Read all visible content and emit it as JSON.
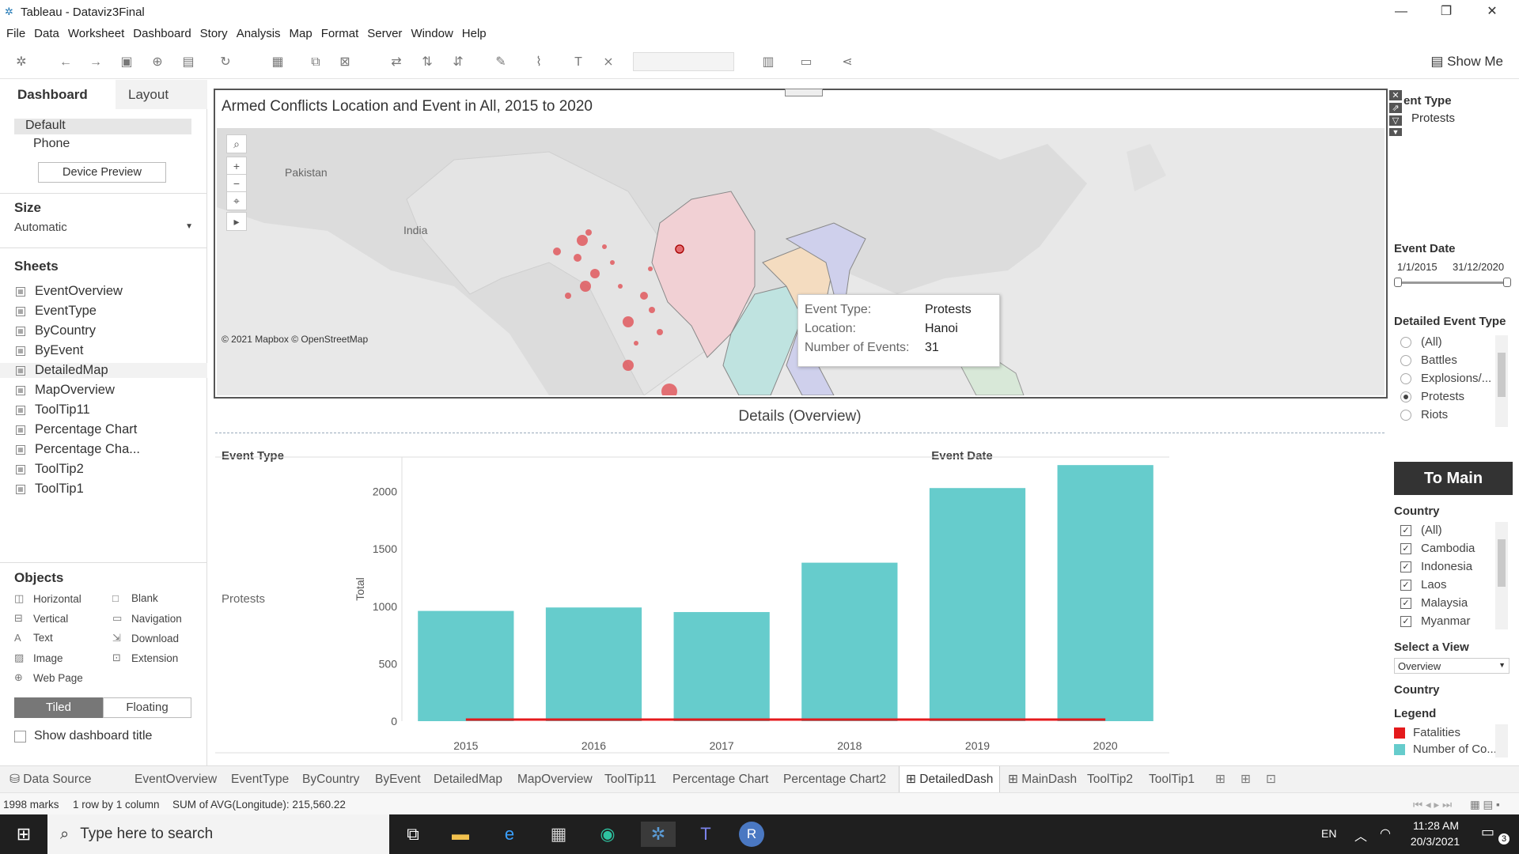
{
  "window": {
    "title": "Tableau - Dataviz3Final"
  },
  "menu": [
    "File",
    "Data",
    "Worksheet",
    "Dashboard",
    "Story",
    "Analysis",
    "Map",
    "Format",
    "Server",
    "Window",
    "Help"
  ],
  "toolbar": {
    "show_me": "Show Me"
  },
  "left_pane": {
    "tab_dashboard": "Dashboard",
    "tab_layout": "Layout",
    "device_default": "Default",
    "device_phone": "Phone",
    "device_preview": "Device Preview",
    "size_header": "Size",
    "size_value": "Automatic",
    "sheets_header": "Sheets",
    "sheets": [
      "EventOverview",
      "EventType",
      "ByCountry",
      "ByEvent",
      "DetailedMap",
      "MapOverview",
      "ToolTip11",
      "Percentage Chart",
      "Percentage Cha...",
      "ToolTip2",
      "ToolTip1"
    ],
    "objects_header": "Objects",
    "objects_left": [
      "Horizontal",
      "Vertical",
      "Text",
      "Image",
      "Web Page"
    ],
    "objects_right": [
      "Blank",
      "Navigation",
      "Download",
      "Extension"
    ],
    "tiled": "Tiled",
    "floating": "Floating",
    "show_title": "Show dashboard title"
  },
  "map": {
    "title": "Armed Conflicts Location and Event in All, 2015 to 2020",
    "labels": {
      "pakistan": "Pakistan",
      "india": "India"
    },
    "attribution": "© 2021 Mapbox © OpenStreetMap",
    "tooltip": {
      "k1": "Event Type:",
      "v1": "Protests",
      "k2": "Location:",
      "v2": "Hanoi",
      "k3": "Number of Events:",
      "v3": "31"
    }
  },
  "details": {
    "title": "Details (Overview)",
    "col_event_type": "Event Type",
    "col_event_date": "Event Date",
    "row_label": "Protests"
  },
  "chart_data": {
    "type": "bar",
    "categories": [
      "2015",
      "2016",
      "2017",
      "2018",
      "2019",
      "2020"
    ],
    "series": [
      {
        "name": "Number of Co...",
        "color": "#66cccc",
        "values": [
          960,
          990,
          950,
          1380,
          2030,
          2230
        ]
      },
      {
        "name": "Fatalities",
        "color": "#e41a1c",
        "values": [
          0,
          0,
          0,
          0,
          0,
          0
        ]
      }
    ],
    "ylabel": "Total",
    "ylim": [
      0,
      2300
    ],
    "yticks": [
      0,
      500,
      1000,
      1500,
      2000
    ]
  },
  "right_pane": {
    "event_type_header": "ent Type",
    "event_type_value": "Protests",
    "event_date_header": "Event Date",
    "date_start": "1/1/2015",
    "date_end": "31/12/2020",
    "detailed_event_type_header": "Detailed Event Type",
    "detailed_options": [
      "(All)",
      "Battles",
      "Explosions/...",
      "Protests",
      "Riots"
    ],
    "detailed_selected": "Protests",
    "to_main": "To Main",
    "country_header": "Country",
    "countries": [
      "(All)",
      "Cambodia",
      "Indonesia",
      "Laos",
      "Malaysia",
      "Myanmar"
    ],
    "select_view_header": "Select a View",
    "select_view_value": "Overview",
    "country2_header": "Country",
    "legend_header": "Legend",
    "legend": [
      {
        "label": "Fatalities",
        "color": "#e41a1c"
      },
      {
        "label": "Number of Co...",
        "color": "#66cccc"
      }
    ]
  },
  "tabs": [
    "Data Source",
    "EventOverview",
    "EventType",
    "ByCountry",
    "ByEvent",
    "DetailedMap",
    "MapOverview",
    "ToolTip11",
    "Percentage Chart",
    "Percentage Chart2",
    "DetailedDash",
    "MainDash",
    "ToolTip2",
    "ToolTip1"
  ],
  "active_tab": "DetailedDash",
  "status": {
    "marks": "1998 marks",
    "rows": "1 row by 1 column",
    "sum": "SUM of AVG(Longitude): 215,560.22"
  },
  "taskbar": {
    "search": "Type here to search",
    "lang": "EN",
    "time": "11:28 AM",
    "date": "20/3/2021",
    "notif": "3"
  }
}
